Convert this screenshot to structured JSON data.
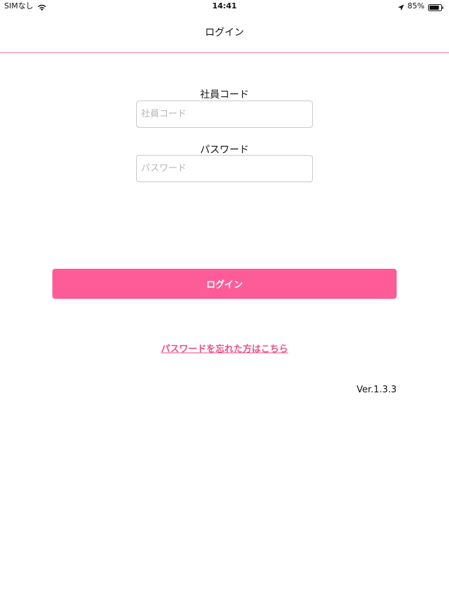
{
  "status_bar": {
    "carrier": "SIMなし",
    "time": "14:41",
    "battery_percent": "85%",
    "battery_level": 0.85,
    "wifi_icon": "wifi-icon",
    "location_icon": "location-arrow-icon",
    "battery_icon": "battery-icon"
  },
  "nav": {
    "title": "ログイン"
  },
  "form": {
    "employee_code": {
      "label": "社員コード",
      "placeholder": "社員コード",
      "value": ""
    },
    "password": {
      "label": "パスワード",
      "placeholder": "パスワード",
      "value": ""
    },
    "login_button_label": "ログイン",
    "forgot_password_link": "パスワードを忘れた方はこちら"
  },
  "version": "Ver.1.3.3",
  "colors": {
    "accent": "#fe5c98",
    "link": "#f0508a",
    "divider": "#f07aa0"
  }
}
